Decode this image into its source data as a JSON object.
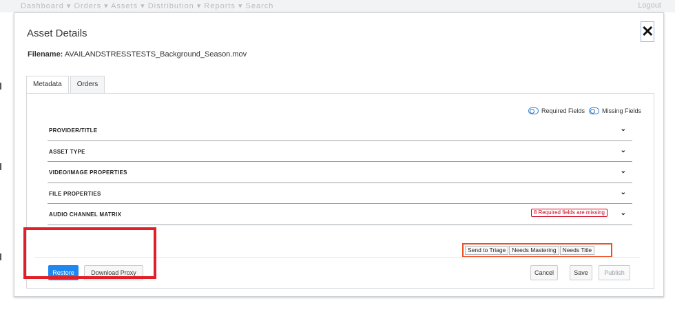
{
  "background": {
    "nav_text": "Dashboard ▾  Orders ▾  Assets ▾  Distribution ▾  Reports ▾  Search",
    "nav_right": "Logout"
  },
  "modal": {
    "title": "Asset Details",
    "close_label": "✕",
    "filename_label": "Filename:",
    "filename_value": "AVAILANDSTRESSTESTS_Background_Season.mov",
    "tabs": [
      {
        "label": "Metadata",
        "active": true
      },
      {
        "label": "Orders",
        "active": false
      }
    ],
    "legend": {
      "required": "Required Fields",
      "missing": "Missing Fields"
    },
    "sections": [
      {
        "title": "PROVIDER/TITLE"
      },
      {
        "title": "ASSET TYPE"
      },
      {
        "title": "VIDEO/IMAGE PROPERTIES"
      },
      {
        "title": "FILE PROPERTIES"
      },
      {
        "title": "AUDIO CHANNEL MATRIX",
        "badge": "8 Required fields are missing"
      }
    ],
    "status_buttons": [
      "Send to Triage",
      "Needs Mastering",
      "Needs Title"
    ],
    "footer": {
      "restore": "Restore",
      "download_proxy": "Download Proxy",
      "cancel": "Cancel",
      "save": "Save",
      "publish": "Publish"
    }
  },
  "colors": {
    "primary_button": "#1e88f0",
    "error_red": "#d0021b",
    "highlight_red": "#e21f26",
    "highlight_orange": "#f04e23",
    "toggle_blue": "#2f7ad0"
  },
  "icons": {
    "close": "close-icon",
    "chevron": "chevron-down-icon",
    "toggle": "toggle-icon"
  }
}
